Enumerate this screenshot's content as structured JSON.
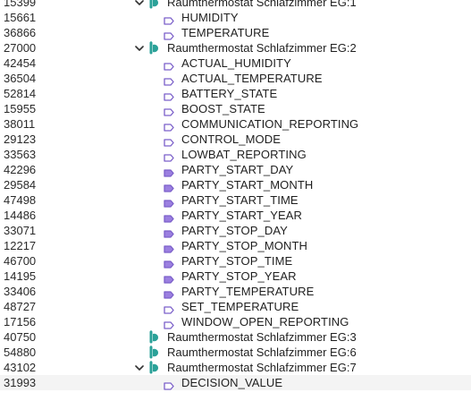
{
  "colors": {
    "device_icon": "#2aa198",
    "datapoint_icon_outline": "#7b5fc9",
    "datapoint_icon_fill": "#9b7fe0",
    "chevron": "#333333"
  },
  "tree": [
    {
      "id": "15399",
      "kind": "device",
      "label": "Raumthermostat Schlafzimmer EG:1",
      "expanded": true,
      "icon": "thermostat-device-icon"
    },
    {
      "id": "15661",
      "kind": "datapoint",
      "label": "HUMIDITY",
      "icon": "datapoint-icon",
      "filled": false
    },
    {
      "id": "36866",
      "kind": "datapoint",
      "label": "TEMPERATURE",
      "icon": "datapoint-icon",
      "filled": false
    },
    {
      "id": "27000",
      "kind": "device",
      "label": "Raumthermostat Schlafzimmer EG:2",
      "expanded": true,
      "icon": "thermostat-device-icon"
    },
    {
      "id": "42454",
      "kind": "datapoint",
      "label": "ACTUAL_HUMIDITY",
      "icon": "datapoint-icon",
      "filled": false
    },
    {
      "id": "36504",
      "kind": "datapoint",
      "label": "ACTUAL_TEMPERATURE",
      "icon": "datapoint-icon",
      "filled": false
    },
    {
      "id": "52814",
      "kind": "datapoint",
      "label": "BATTERY_STATE",
      "icon": "datapoint-icon",
      "filled": false
    },
    {
      "id": "15955",
      "kind": "datapoint",
      "label": "BOOST_STATE",
      "icon": "datapoint-icon",
      "filled": false
    },
    {
      "id": "38011",
      "kind": "datapoint",
      "label": "COMMUNICATION_REPORTING",
      "icon": "datapoint-icon",
      "filled": false
    },
    {
      "id": "29123",
      "kind": "datapoint",
      "label": "CONTROL_MODE",
      "icon": "datapoint-icon",
      "filled": false
    },
    {
      "id": "33563",
      "kind": "datapoint",
      "label": "LOWBAT_REPORTING",
      "icon": "datapoint-icon",
      "filled": false
    },
    {
      "id": "42296",
      "kind": "datapoint",
      "label": "PARTY_START_DAY",
      "icon": "datapoint-icon",
      "filled": true
    },
    {
      "id": "29584",
      "kind": "datapoint",
      "label": "PARTY_START_MONTH",
      "icon": "datapoint-icon",
      "filled": true
    },
    {
      "id": "47498",
      "kind": "datapoint",
      "label": "PARTY_START_TIME",
      "icon": "datapoint-icon",
      "filled": true
    },
    {
      "id": "14486",
      "kind": "datapoint",
      "label": "PARTY_START_YEAR",
      "icon": "datapoint-icon",
      "filled": true
    },
    {
      "id": "33071",
      "kind": "datapoint",
      "label": "PARTY_STOP_DAY",
      "icon": "datapoint-icon",
      "filled": true
    },
    {
      "id": "12217",
      "kind": "datapoint",
      "label": "PARTY_STOP_MONTH",
      "icon": "datapoint-icon",
      "filled": true
    },
    {
      "id": "46700",
      "kind": "datapoint",
      "label": "PARTY_STOP_TIME",
      "icon": "datapoint-icon",
      "filled": true
    },
    {
      "id": "14195",
      "kind": "datapoint",
      "label": "PARTY_STOP_YEAR",
      "icon": "datapoint-icon",
      "filled": true
    },
    {
      "id": "33406",
      "kind": "datapoint",
      "label": "PARTY_TEMPERATURE",
      "icon": "datapoint-icon",
      "filled": true
    },
    {
      "id": "48727",
      "kind": "datapoint",
      "label": "SET_TEMPERATURE",
      "icon": "datapoint-icon",
      "filled": false
    },
    {
      "id": "17156",
      "kind": "datapoint",
      "label": "WINDOW_OPEN_REPORTING",
      "icon": "datapoint-icon",
      "filled": false
    },
    {
      "id": "40750",
      "kind": "device",
      "label": "Raumthermostat Schlafzimmer EG:3",
      "expanded": false,
      "icon": "thermostat-device-icon"
    },
    {
      "id": "54880",
      "kind": "device",
      "label": "Raumthermostat Schlafzimmer EG:6",
      "expanded": false,
      "icon": "thermostat-device-icon"
    },
    {
      "id": "43102",
      "kind": "device",
      "label": "Raumthermostat Schlafzimmer EG:7",
      "expanded": true,
      "icon": "thermostat-device-icon"
    },
    {
      "id": "31993",
      "kind": "datapoint",
      "label": "DECISION_VALUE",
      "icon": "datapoint-icon",
      "filled": false
    }
  ]
}
